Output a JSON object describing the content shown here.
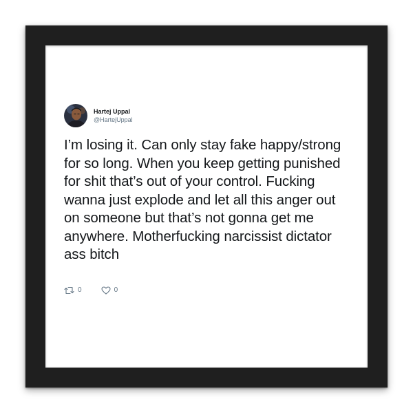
{
  "tweet": {
    "display_name": "Hartej Uppal",
    "handle": "@HartejUppal",
    "text": "I’m losing it. Can only stay fake happy/strong for so long. When you keep getting punished for shit that’s out of your control. Fucking wanna just explode and let all this anger out on someone but that’s not gonna get me anywhere. Motherfucking narcissist dictator ass bitch",
    "retweet_count": "0",
    "like_count": "0"
  },
  "icons": {
    "avatar": "avatar-icon",
    "retweet": "retweet-icon",
    "like": "heart-icon"
  },
  "colors": {
    "frame": "#1f1f1f",
    "mat": "#ffffff",
    "text": "#14171a",
    "secondary": "#657786"
  }
}
